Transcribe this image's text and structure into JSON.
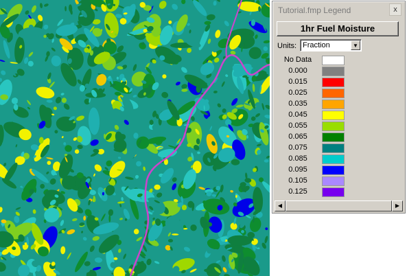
{
  "legend": {
    "title": "Tutorial.fmp Legend",
    "close_label": "x",
    "layer_button": "1hr Fuel Moisture",
    "units_label": "Units:",
    "units_value": "Fraction",
    "entries": [
      {
        "label": "No Data",
        "color": "#ffffff"
      },
      {
        "label": "0.000",
        "color": "#808080"
      },
      {
        "label": "0.015",
        "color": "#ff0000"
      },
      {
        "label": "0.025",
        "color": "#ff6600"
      },
      {
        "label": "0.035",
        "color": "#ffa500"
      },
      {
        "label": "0.045",
        "color": "#ffff00"
      },
      {
        "label": "0.055",
        "color": "#99dd00"
      },
      {
        "label": "0.065",
        "color": "#008000"
      },
      {
        "label": "0.075",
        "color": "#008080"
      },
      {
        "label": "0.085",
        "color": "#00cccc"
      },
      {
        "label": "0.095",
        "color": "#0000ff"
      },
      {
        "label": "0.105",
        "color": "#aa88ff"
      },
      {
        "label": "0.125",
        "color": "#7700ee"
      }
    ]
  },
  "map": {
    "river_color": "#cc44cc"
  }
}
